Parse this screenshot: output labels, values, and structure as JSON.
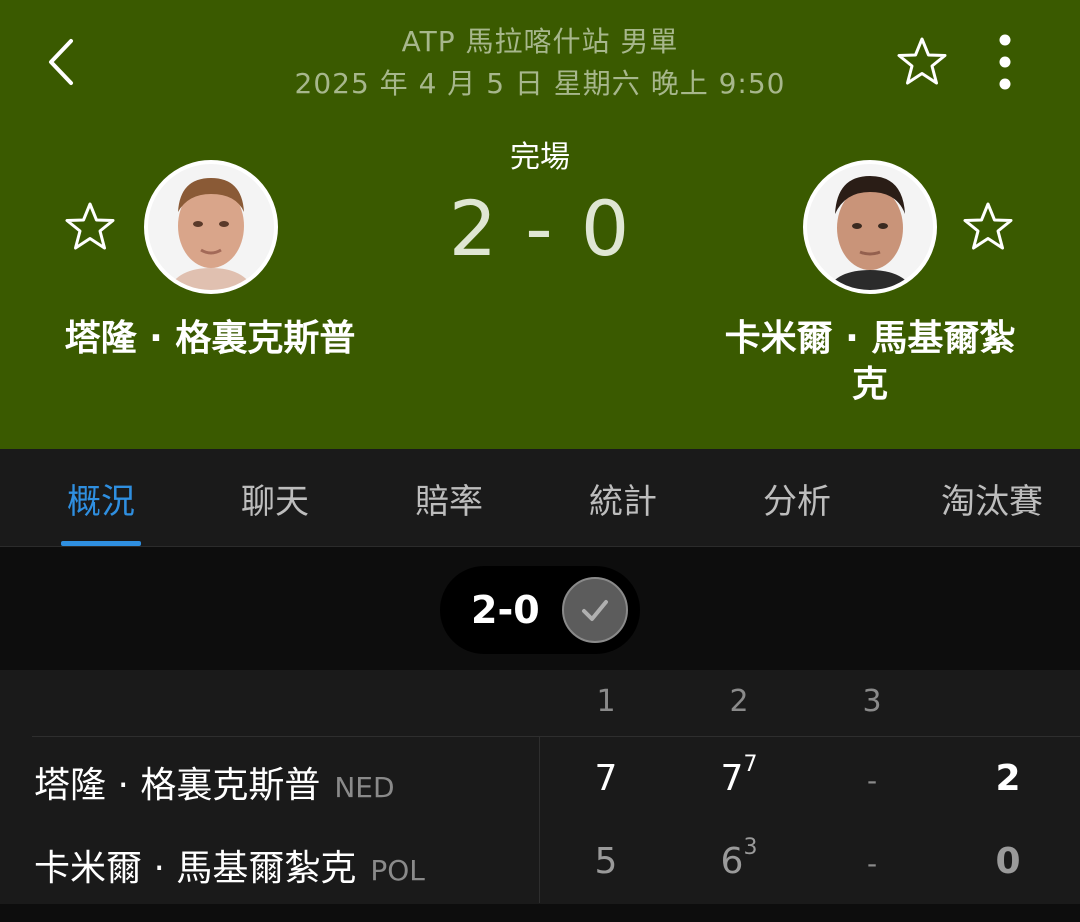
{
  "header": {
    "tournament": "ATP 馬拉喀什站 男單",
    "datetime": "2025 年 4 月 5 日 星期六 晚上 9:50",
    "status": "完場",
    "score": "2 - 0",
    "background_color": "#3a5a00",
    "icons": {
      "back": "chevron-left-icon",
      "favorite": "star-outline-icon",
      "more": "more-vertical-icon"
    }
  },
  "players": {
    "home": {
      "name": "塔隆 · 格裏克斯普",
      "country": "NED"
    },
    "away": {
      "name_line1": "卡米爾 · 馬基爾紮",
      "name_line2": "克",
      "name": "卡米爾 · 馬基爾紮克",
      "country": "POL"
    }
  },
  "tabs": [
    {
      "label": "概況",
      "active": true
    },
    {
      "label": "聊天",
      "active": false
    },
    {
      "label": "賠率",
      "active": false
    },
    {
      "label": "統計",
      "active": false
    },
    {
      "label": "分析",
      "active": false
    },
    {
      "label": "淘汰賽",
      "active": false
    }
  ],
  "accent_color": "#2f8fe0",
  "set_selector": {
    "label": "2-0",
    "icon": "check-circle-icon"
  },
  "scoreboard": {
    "set_headers": [
      "1",
      "2",
      "3"
    ],
    "rows": [
      {
        "sets": [
          "7",
          "7",
          "-"
        ],
        "tiebreaks": [
          "",
          "7",
          ""
        ],
        "total": "2"
      },
      {
        "sets": [
          "5",
          "6",
          "-"
        ],
        "tiebreaks": [
          "",
          "3",
          ""
        ],
        "total": "0"
      }
    ]
  }
}
